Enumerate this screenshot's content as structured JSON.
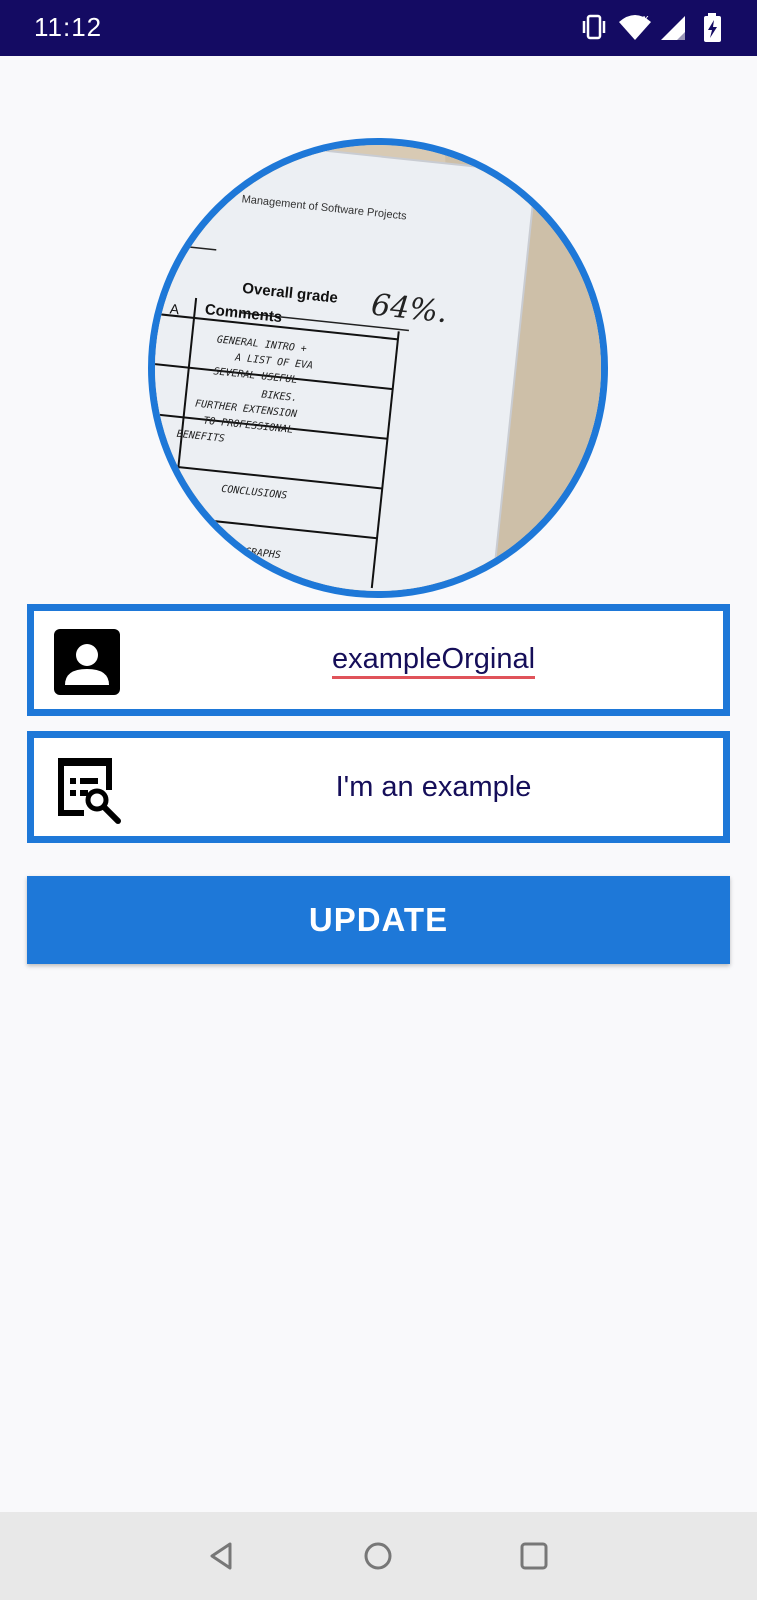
{
  "status_bar": {
    "time": "11:12",
    "icons": [
      "vibrate-icon",
      "wifi-icon",
      "signal-icon",
      "battery-charging-icon"
    ],
    "background": "#140b63"
  },
  "profile": {
    "photo": "document-photo"
  },
  "fields": {
    "username": {
      "value": "exampleOrginal",
      "icon": "account-box-icon"
    },
    "description": {
      "value": "I'm an example",
      "icon": "edit-document-icon"
    }
  },
  "actions": {
    "update_label": "UPDATE"
  },
  "nav_bar": {
    "items": [
      "back-icon",
      "home-icon",
      "recents-icon"
    ]
  },
  "colors": {
    "accent": "#1e78d8",
    "text": "#150e59"
  }
}
